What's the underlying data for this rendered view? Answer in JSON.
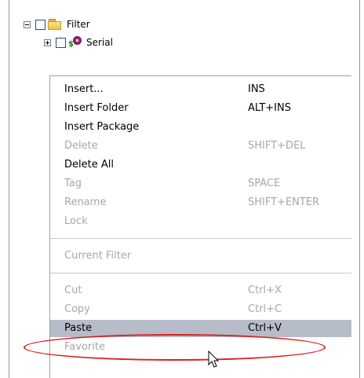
{
  "tree": {
    "items": [
      {
        "label": "Filter",
        "expanded": true,
        "icon": "folder-icon",
        "checked": false
      },
      {
        "label": "Serial",
        "expanded": false,
        "icon": "serial-icon",
        "checked": false
      }
    ]
  },
  "context_menu": {
    "items": [
      {
        "label": "Insert...",
        "shortcut": "INS",
        "enabled": true
      },
      {
        "label": "Insert Folder",
        "shortcut": "ALT+INS",
        "enabled": true
      },
      {
        "label": "Insert Package",
        "shortcut": "",
        "enabled": true
      },
      {
        "label": "Delete",
        "shortcut": "SHIFT+DEL",
        "enabled": false
      },
      {
        "label": "Delete All",
        "shortcut": "",
        "enabled": true
      },
      {
        "label": "Tag",
        "shortcut": "SPACE",
        "enabled": false
      },
      {
        "label": "Rename",
        "shortcut": "SHIFT+ENTER",
        "enabled": false
      },
      {
        "label": "Lock",
        "shortcut": "",
        "enabled": false
      },
      {
        "label": "Current Filter",
        "shortcut": "",
        "enabled": false
      },
      {
        "label": "Cut",
        "shortcut": "Ctrl+X",
        "enabled": false
      },
      {
        "label": "Copy",
        "shortcut": "Ctrl+C",
        "enabled": false
      },
      {
        "label": "Paste",
        "shortcut": "Ctrl+V",
        "enabled": true,
        "highlighted": true
      },
      {
        "label": "Favorite",
        "shortcut": "",
        "enabled": false
      }
    ]
  },
  "colors": {
    "highlight": "#b6bcc8",
    "disabled_text": "#a7a7a7",
    "annotation": "#e11e1e"
  }
}
